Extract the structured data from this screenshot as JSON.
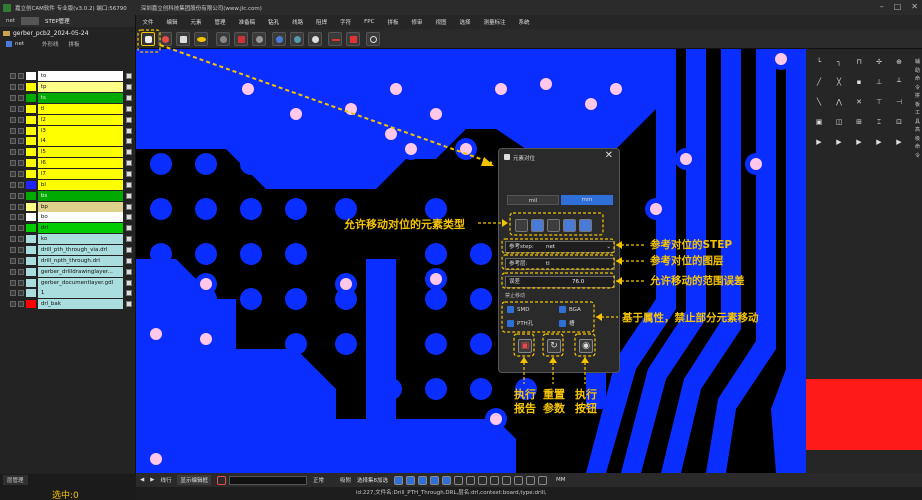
{
  "titlebar": {
    "app_title": "嘉立创CAM软件 专业版(v3.0.2) 端口:56790",
    "company": "深圳嘉立创科技集团股份有限公司(www.jlc.com)"
  },
  "menu": [
    "文件",
    "编辑",
    "元素",
    "管理",
    "准备稿",
    "钻孔",
    "线路",
    "阻焊",
    "字符",
    "FPC",
    "拼板",
    "修审",
    "视图",
    "选择",
    "测量标注",
    "系统"
  ],
  "left_panel": {
    "tabs": [
      "net",
      "STEP管理"
    ],
    "job_name": "gerber_pcb2_2024-05-24",
    "step_name": "net",
    "opt_outline": "外形线",
    "opt_panel": "拼板",
    "layers": [
      {
        "name": "to",
        "color": "#ffffff",
        "bg": "#ffffff"
      },
      {
        "name": "tp",
        "color": "#ffff00",
        "bg": "#ffff88"
      },
      {
        "name": "ts",
        "color": "#00aa00",
        "bg": "#00aa00"
      },
      {
        "name": "tl",
        "color": "#ffff00",
        "bg": "#ffff00"
      },
      {
        "name": "l2",
        "color": "#ffff00",
        "bg": "#ffff00"
      },
      {
        "name": "l3",
        "color": "#ffff00",
        "bg": "#ffff00"
      },
      {
        "name": "l4",
        "color": "#ffff00",
        "bg": "#ffff00"
      },
      {
        "name": "l5",
        "color": "#ffff00",
        "bg": "#ffff00"
      },
      {
        "name": "l6",
        "color": "#ffff00",
        "bg": "#ffff00"
      },
      {
        "name": "l7",
        "color": "#ffff00",
        "bg": "#ffff00"
      },
      {
        "name": "bl",
        "color": "#2222ff",
        "bg": "#ffff00"
      },
      {
        "name": "bs",
        "color": "#00aa00",
        "bg": "#00aa00"
      },
      {
        "name": "bp",
        "color": "#ffff88",
        "bg": "#dcd08a"
      },
      {
        "name": "bo",
        "color": "#ffffff",
        "bg": "#ffffff"
      },
      {
        "name": "drl",
        "color": "#00cc00",
        "bg": "#00cc00"
      },
      {
        "name": "ko",
        "color": "#aadddd",
        "bg": "#aadddd"
      },
      {
        "name": "drill_pth_through_via.drl",
        "color": "#aadddd",
        "bg": "#aadddd"
      },
      {
        "name": "drill_npth_through.drl",
        "color": "#aadddd",
        "bg": "#aadddd"
      },
      {
        "name": "gerber_drilldrawinglayer...",
        "color": "#aadddd",
        "bg": "#aadddd"
      },
      {
        "name": "gerber_documentlayer.gdl",
        "color": "#aadddd",
        "bg": "#aadddd"
      },
      {
        "name": "1",
        "color": "#aadddd",
        "bg": "#aadddd"
      },
      {
        "name": "drl_bak",
        "color": "#ff0000",
        "bg": "#aadddd"
      }
    ],
    "bottom_btn": "层管理",
    "selected_label": "选中:0"
  },
  "dialog": {
    "title": "元素对位",
    "unit_mil": "mil",
    "unit_mm": "mm",
    "ref_step_label": "参考step:",
    "ref_step_value": "net",
    "ref_layer_label": "参考层:",
    "ref_layer_value": "tl",
    "tolerance_label": "误差",
    "tolerance_value": "76.0",
    "forbid_group": "禁止移动",
    "chk_smd": "SMD",
    "chk_bga": "BGA",
    "chk_pth": "PTH孔",
    "chk_slot": "槽"
  },
  "annotations": {
    "element_type": "允许移动对位的元素类型",
    "ref_step": "参考对位的STEP",
    "ref_layer": "参考对位的图层",
    "tolerance": "允许移动的范围误差",
    "forbid": "基于属性，禁止部分元素移动",
    "report_1": "执行",
    "report_2": "报告",
    "reset_1": "重置",
    "reset_2": "参数",
    "exec_1": "执行",
    "exec_2": "按钮"
  },
  "bottombar": {
    "mode": "线行",
    "show_btn": "显示编辑框",
    "normal": "正常",
    "snap": "吸附",
    "net_btn": "选择集8加选",
    "unit": "MM"
  },
  "status": "id:227,文件名:Drill_PTH_Through.DRL,层名:drl,context:board,type:drill,",
  "right_panel_vtext": [
    "辅",
    "助",
    "命",
    "令",
    "拼",
    "板",
    "工",
    "具",
    "高",
    "级",
    "命",
    "令"
  ],
  "colors": {
    "board_blue": "#0a2eff",
    "pad_pink": "#ffc8e8",
    "annotation": "#f5c400",
    "drc_red": "#ff1a1a"
  }
}
